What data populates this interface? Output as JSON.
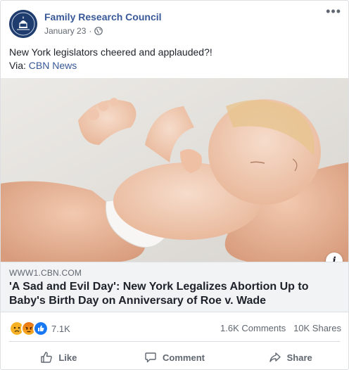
{
  "post": {
    "page_name": "Family Research Council",
    "date": "January 23",
    "separator": "·",
    "text": "New York legislators cheered and applauded?!",
    "via_label": "Via:",
    "via_link": "CBN News"
  },
  "link_preview": {
    "domain": "WWW1.CBN.COM",
    "headline": "'A Sad and Evil Day': New York Legalizes Abortion Up to Baby's Birth Day on Anniversary of Roe v. Wade",
    "info_label": "i"
  },
  "stats": {
    "reaction_count": "7.1K",
    "comments": "1.6K Comments",
    "shares": "10K Shares",
    "reaction_icons": [
      "sad-reaction-icon",
      "angry-reaction-icon",
      "like-reaction-icon"
    ]
  },
  "actions": {
    "like": "Like",
    "comment": "Comment",
    "share": "Share"
  },
  "colors": {
    "link_blue": "#385898",
    "like_blue": "#1877f2",
    "sad_yellow": "#f7b125",
    "angry_orange": "#e9710f"
  }
}
